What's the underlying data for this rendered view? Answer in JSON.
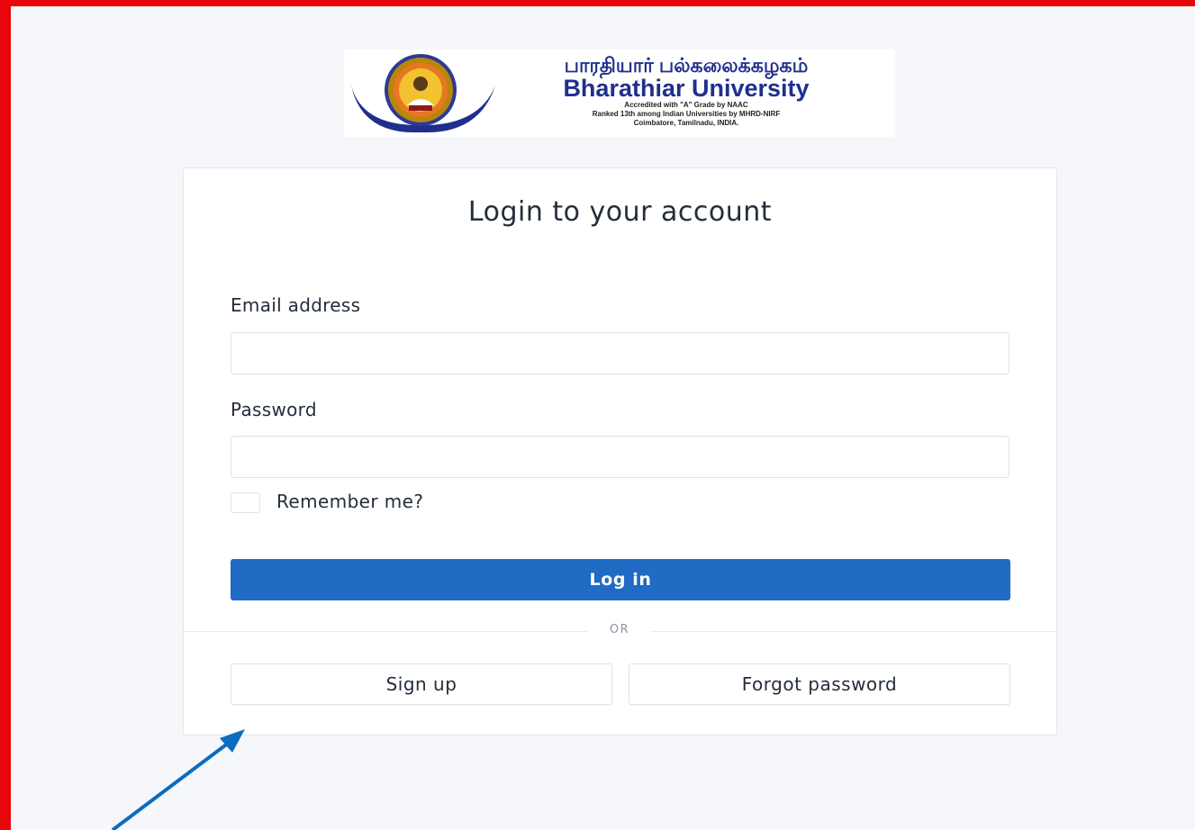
{
  "logo": {
    "tamil": "பாரதியார் பல்கலைக்கழகம்",
    "english": "Bharathiar University",
    "line1": "Accredited with \"A\" Grade by NAAC",
    "line2": "Ranked 13th among Indian Universities by MHRD-NIRF",
    "line3": "Coimbatore, Tamilnadu, INDIA."
  },
  "form": {
    "title": "Login to your account",
    "email_label": "Email address",
    "email_value": "",
    "password_label": "Password",
    "password_value": "",
    "remember_label": "Remember me?",
    "login_label": "Log in",
    "or_label": "OR",
    "signup_label": "Sign up",
    "forgot_label": "Forgot password"
  },
  "colors": {
    "frame": "#e8060a",
    "primary": "#206bc4",
    "annotation_arrow": "#0b6cc0"
  },
  "icons": {
    "logo_emblem": "university-emblem-icon",
    "annotation": "arrow-icon"
  }
}
